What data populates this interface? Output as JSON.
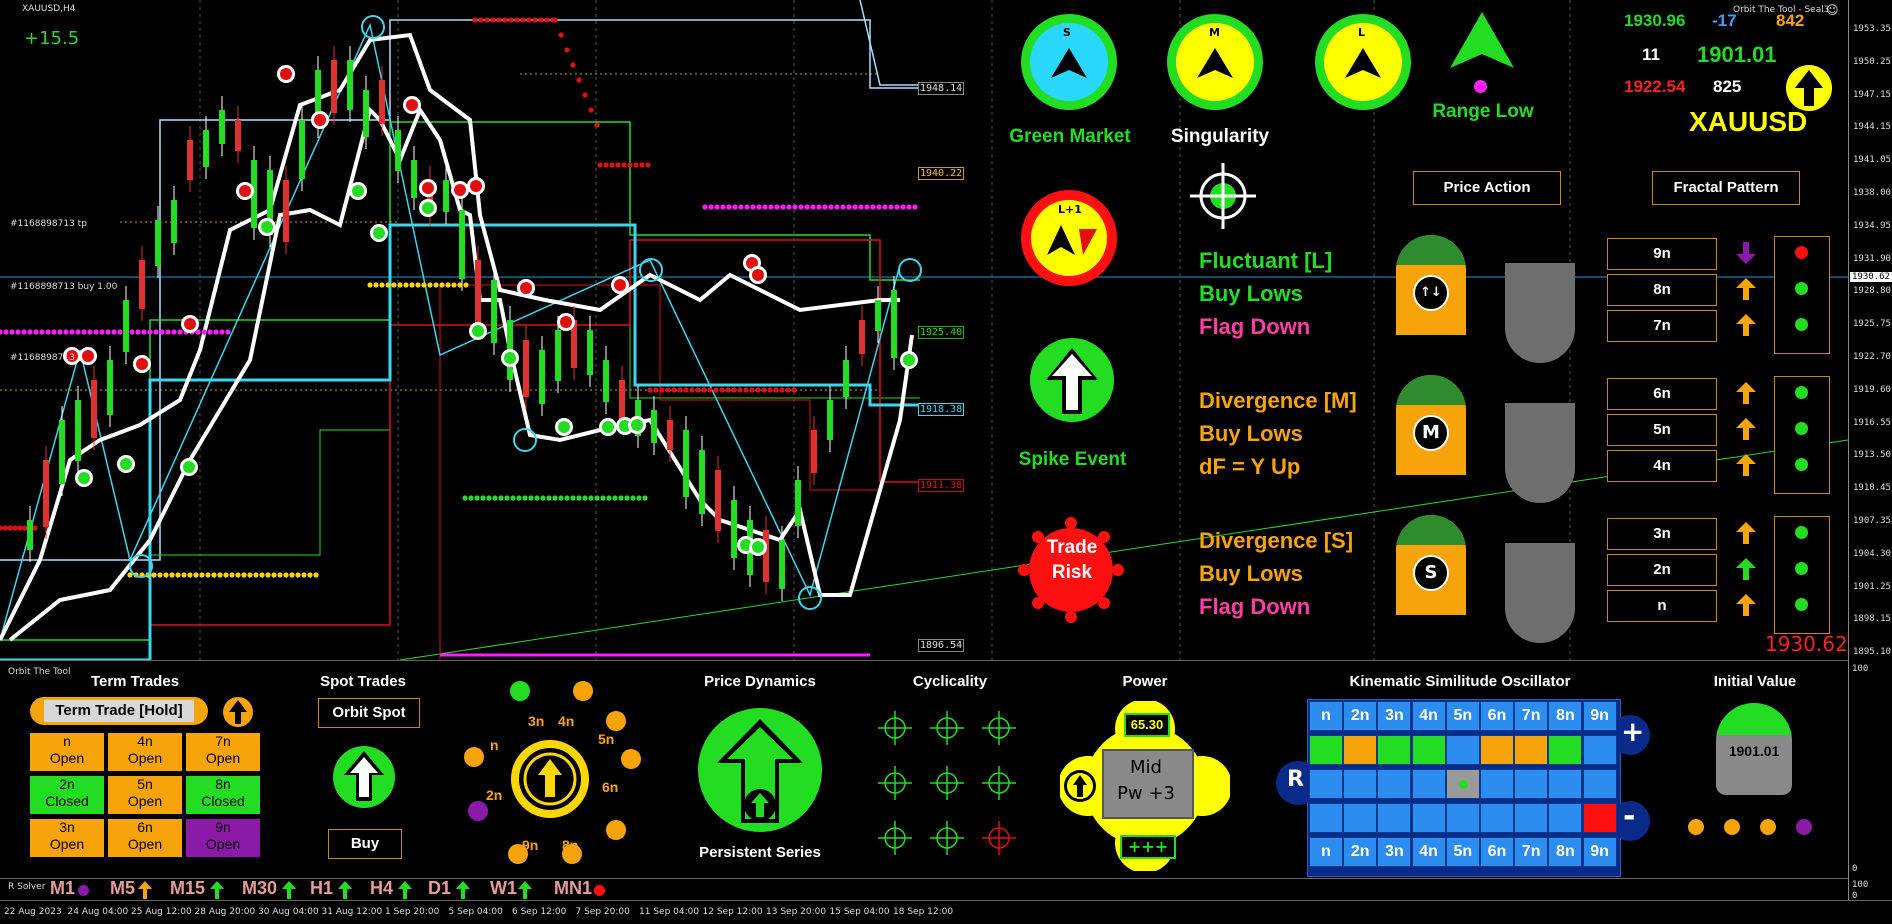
{
  "chart": {
    "symbol_title": "XAUUSD,H4",
    "pips_value": "+15.5",
    "label_tp": "#1168898713 tp",
    "label_buy": "#1168898713 buy 1.00",
    "label_order": "#1168898713",
    "top_right_brand": "Orbit The Tool - Seal3",
    "price_tags": [
      "1948.14",
      "1940.22",
      "1925.40",
      "1918.38",
      "1911.38",
      "1896.54"
    ],
    "axis_ticks": [
      "1953.35",
      "1950.25",
      "1947.15",
      "1944.15",
      "1941.05",
      "1938.00",
      "1934.95",
      "1931.90",
      "1928.80",
      "1925.75",
      "1922.70",
      "1919.60",
      "1916.55",
      "1913.50",
      "1910.45",
      "1907.35",
      "1904.30",
      "1901.25",
      "1898.15",
      "1895.10"
    ],
    "current_price_tag": "1930.62",
    "colors": {
      "cyan": "#3ad7f0",
      "white_band": "#ffffff",
      "red_dot": "#e01010",
      "magenta": "#ff1dff",
      "yellow_dot": "#ffd700",
      "green_dot": "#22dd22",
      "grid": "#333333"
    }
  },
  "dashboard": {
    "compass_s": {
      "letter": "S",
      "caption": "Green Market"
    },
    "compass_m": {
      "letter": "M"
    },
    "compass_l": {
      "letter": "L",
      "caption": "Singularity"
    },
    "range_low": "Range Low",
    "lplus1": "L+1",
    "spike_event": "Spike Event",
    "trade_risk_line1": "Trade",
    "trade_risk_line2": "Risk",
    "stats": {
      "v1": "1930.96",
      "v2": "-17",
      "v3": "842",
      "v4": "11",
      "v5": "1901.01",
      "v6": "1922.54",
      "v7": "825",
      "symbol": "XAUUSD"
    },
    "price_action": "Price Action",
    "fractal_pattern": "Fractal Pattern",
    "blocks": [
      {
        "line1": "Fluctuant [L]",
        "line2": "Buy Lows",
        "line3": "Flag Down",
        "badge": "↑↓",
        "labels": [
          "9n",
          "8n",
          "7n"
        ]
      },
      {
        "line1": "Divergence [M]",
        "line2": "Buy Lows",
        "line3": "dF = Y Up",
        "badge": "M",
        "labels": [
          "6n",
          "5n",
          "4n"
        ]
      },
      {
        "line1": "Divergence [S]",
        "line2": "Buy Lows",
        "line3": "Flag Down",
        "badge": "S",
        "labels": [
          "3n",
          "2n",
          "n"
        ]
      }
    ],
    "current_price_red": "1930.62"
  },
  "lower": {
    "panel_title": "Orbit The Tool",
    "term_trades": "Term Trades",
    "term_trade_hold": "Term Trade [Hold]",
    "term_cells": [
      {
        "n": "n",
        "s": "Open"
      },
      {
        "n": "4n",
        "s": "Open"
      },
      {
        "n": "7n",
        "s": "Open"
      },
      {
        "n": "2n",
        "s": "Closed"
      },
      {
        "n": "5n",
        "s": "Open"
      },
      {
        "n": "8n",
        "s": "Closed"
      },
      {
        "n": "3n",
        "s": "Open"
      },
      {
        "n": "6n",
        "s": "Open"
      },
      {
        "n": "9n",
        "s": "Open"
      }
    ],
    "spot_trades": "Spot Trades",
    "orbit_spot": "Orbit Spot",
    "buy": "Buy",
    "orbit_labels": [
      "3n",
      "4n",
      "5n",
      "6n",
      "8n",
      "9n",
      "n",
      "2n"
    ],
    "price_dynamics": "Price Dynamics",
    "persistent_series": "Persistent Series",
    "cyclicality": "Cyclicality",
    "power": "Power",
    "power_value": "65.30",
    "power_mid": "Mid",
    "power_pw": "Pw +3",
    "power_plus": "+++",
    "kso_title": "Kinematic Similitude Oscillator",
    "kso_headers": [
      "n",
      "2n",
      "3n",
      "4n",
      "5n",
      "6n",
      "7n",
      "8n",
      "9n"
    ],
    "kso_r": "R",
    "kso_plus": "+",
    "kso_minus": "-",
    "initial_value": "Initial Value",
    "initial_value_num": "1901.01",
    "lower_axis": [
      "100",
      "0"
    ]
  },
  "rsolver": {
    "label": "R Solver",
    "timeframes": [
      "M1",
      "M5",
      "M15",
      "M30",
      "H1",
      "H4",
      "D1",
      "W1",
      "MN1"
    ],
    "axis": [
      "100",
      "0"
    ]
  },
  "time_axis": [
    "22 Aug 2023",
    "24 Aug 04:00",
    "25 Aug 12:00",
    "28 Aug 20:00",
    "30 Aug 04:00",
    "31 Aug 12:00",
    "1 Sep 20:00",
    "5 Sep 04:00",
    "6 Sep 12:00",
    "7 Sep 20:00",
    "11 Sep 04:00",
    "12 Sep 12:00",
    "13 Sep 20:00",
    "15 Sep 04:00",
    "18 Sep 12:00"
  ]
}
